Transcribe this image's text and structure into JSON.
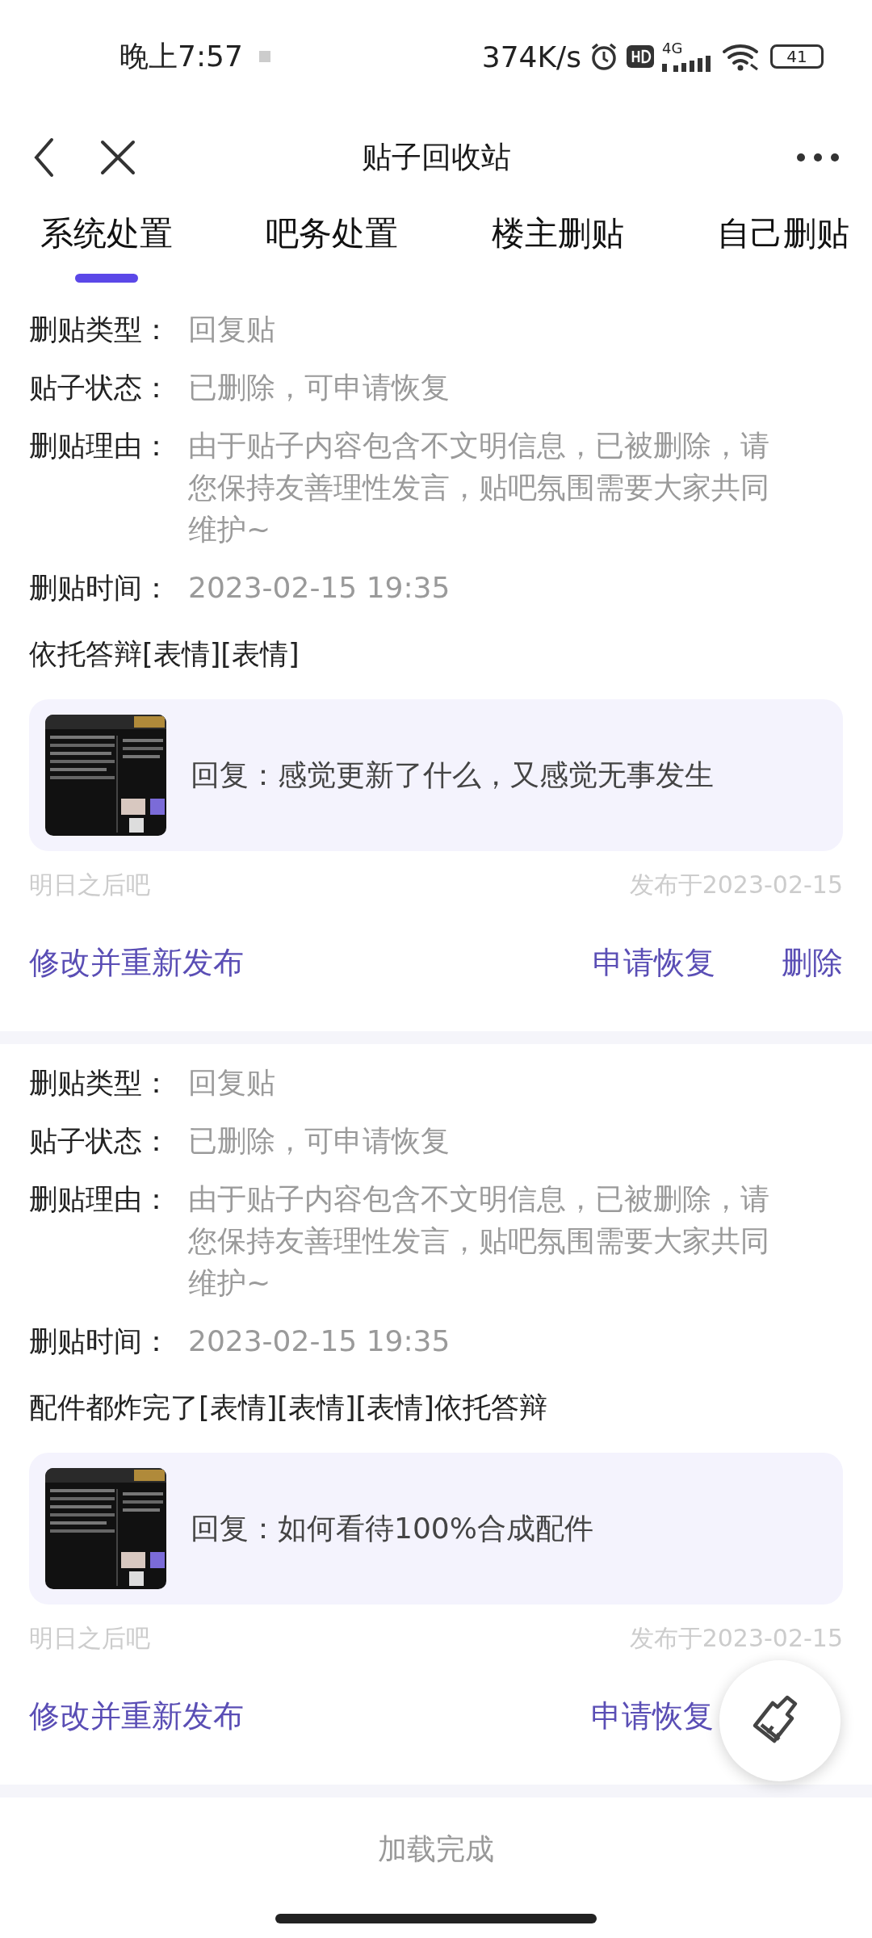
{
  "status_bar": {
    "time": "晚上7:57",
    "speed": "374K/s",
    "network": "4G",
    "battery": "41"
  },
  "nav": {
    "title": "贴子回收站"
  },
  "tabs": [
    {
      "label": "系统处置",
      "selected": true
    },
    {
      "label": "吧务处置",
      "selected": false
    },
    {
      "label": "楼主删贴",
      "selected": false
    },
    {
      "label": "自己删贴",
      "selected": false
    }
  ],
  "posts": [
    {
      "fields": [
        {
          "label": "删贴类型：",
          "value": "回复贴"
        },
        {
          "label": "贴子状态：",
          "value": "已删除，可申请恢复"
        },
        {
          "label": "删贴理由：",
          "value": "由于贴子内容包含不文明信息，已被删除，请您保持友善理性发言，贴吧氛围需要大家共同维护~"
        },
        {
          "label": "删贴时间：",
          "value": "2023-02-15 19:35"
        }
      ],
      "content": "依托答辩[表情][表情]",
      "quote": {
        "text": "回复：感觉更新了什么，又感觉无事发生"
      },
      "forum": "明日之后吧",
      "published": "发布于2023-02-15",
      "edit_button": "修改并重新发布",
      "restore_button": "申请恢复",
      "delete_button": "删除"
    },
    {
      "fields": [
        {
          "label": "删贴类型：",
          "value": "回复贴"
        },
        {
          "label": "贴子状态：",
          "value": "已删除，可申请恢复"
        },
        {
          "label": "删贴理由：",
          "value": "由于贴子内容包含不文明信息，已被删除，请您保持友善理性发言，贴吧氛围需要大家共同维护~"
        },
        {
          "label": "删贴时间：",
          "value": "2023-02-15 19:35"
        }
      ],
      "content": "配件都炸完了[表情][表情][表情]依托答辩",
      "quote": {
        "text": "回复：如何看待100%合成配件"
      },
      "forum": "明日之后吧",
      "published": "发布于2023-02-15",
      "edit_button": "修改并重新发布",
      "restore_button": "申请恢复"
    }
  ],
  "footer": "加载完成"
}
